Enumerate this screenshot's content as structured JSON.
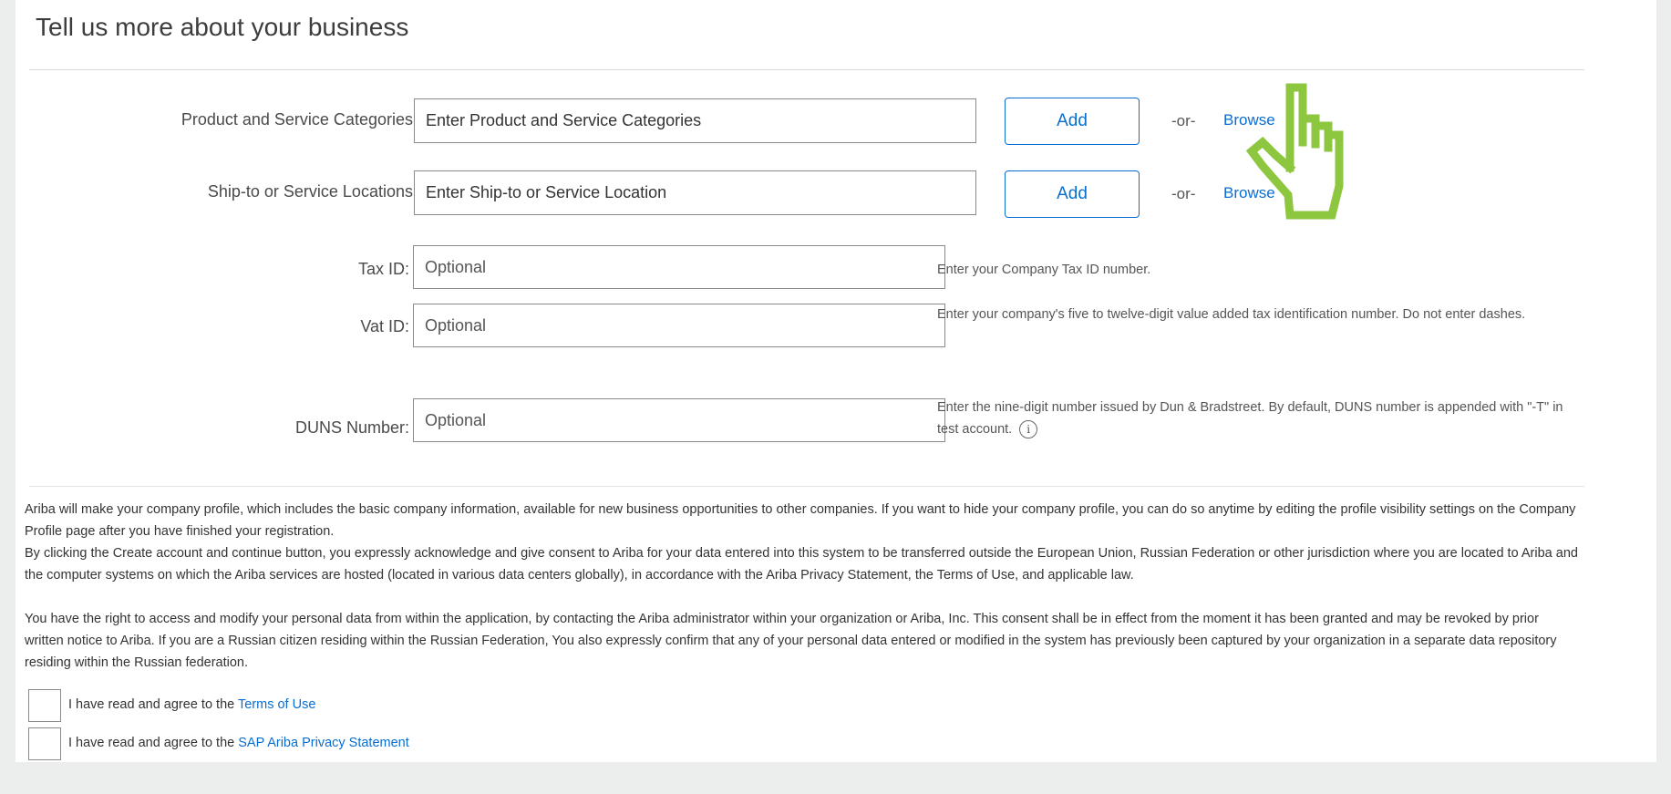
{
  "page": {
    "title": "Tell us more about your business"
  },
  "fields": {
    "categories": {
      "label": "Product and Service Categories:",
      "required_mark": "*",
      "placeholder": "Enter Product and Service Categories",
      "add_label": "Add",
      "or_text": "-or-",
      "browse_label": "Browse"
    },
    "locations": {
      "label": "Ship-to or Service Locations:",
      "required_mark": "*",
      "placeholder": "Enter Ship-to or Service Location",
      "add_label": "Add",
      "or_text": "-or-",
      "browse_label": "Browse"
    },
    "tax_id": {
      "label": "Tax ID:",
      "placeholder": "Optional",
      "hint": "Enter your Company Tax ID number."
    },
    "vat_id": {
      "label": "Vat ID:",
      "placeholder": "Optional",
      "hint": "Enter your company's five to twelve-digit value added tax identification number. Do not enter dashes."
    },
    "duns": {
      "label": "DUNS Number:",
      "placeholder": "Optional",
      "hint": "Enter the nine-digit number issued by Dun & Bradstreet. By default, DUNS number is appended with \"-T\" in test account.",
      "info_icon": "info-icon"
    }
  },
  "legal": {
    "profile_notice": "Ariba will make your company profile, which includes the basic company information, available for new business opportunities to other companies. If you want to hide your company profile, you can do so anytime by editing the profile visibility settings on the Company Profile page after you have finished your registration.",
    "consent_notice": "By clicking the Create account and continue button, you expressly acknowledge and give consent to Ariba for your data entered into this system to be transferred outside the European Union, Russian Federation or other jurisdiction where you are located to Ariba and the computer systems on which the Ariba services are hosted (located in various data centers globally), in accordance with the Ariba Privacy Statement, the Terms of Use, and applicable law.",
    "rights_notice": "You have the right to access and modify your personal data from within the application, by contacting the Ariba administrator within your organization or Ariba, Inc. This consent shall be in effect from the moment it has been granted and may be revoked by prior written notice to Ariba. If you are a Russian citizen residing within the Russian Federation, You also expressly confirm that any of your personal data entered or modified in the system has previously been captured by your organization in a separate data repository residing within the Russian federation."
  },
  "agreements": {
    "terms": {
      "prefix": "I have read and agree to the",
      "link": "Terms of Use"
    },
    "privacy": {
      "prefix": "I have read and agree to the",
      "link": "SAP Ariba Privacy Statement"
    }
  },
  "icons": {
    "cursor": "hand-pointer-icon",
    "info": "info-icon"
  },
  "colors": {
    "accent": "#0a6ed1",
    "cursor": "#8dc63f",
    "background": "#eceded"
  }
}
